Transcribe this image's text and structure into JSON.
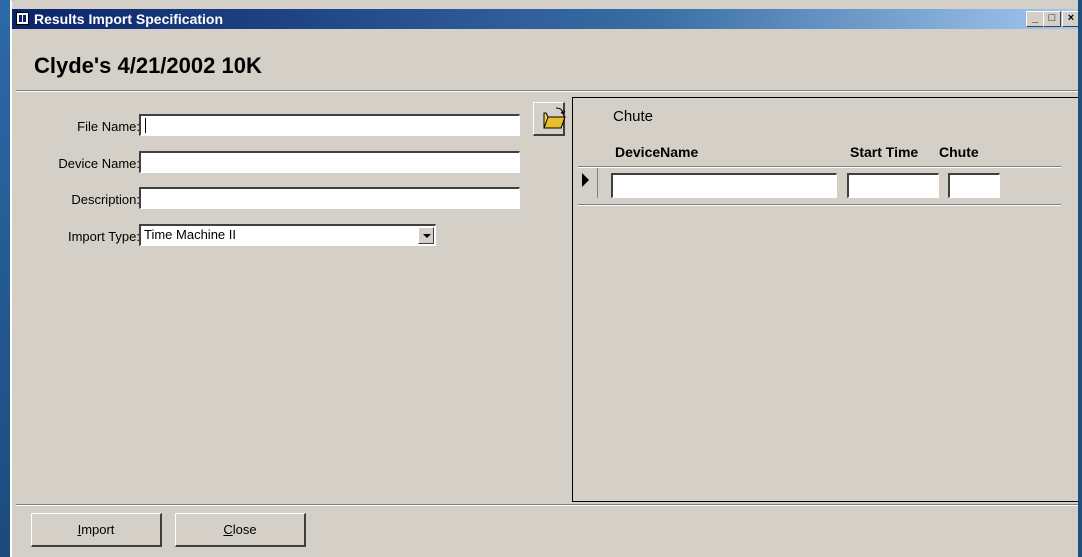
{
  "window": {
    "title": "Results Import Specification",
    "minimize": "_",
    "maximize": "□",
    "close": "×"
  },
  "form": {
    "title": "Clyde's 4/21/2002 10K",
    "file_name_label": "File Name:",
    "file_name_value": "",
    "device_name_label": "Device Name:",
    "device_name_value": "",
    "description_label": "Description:",
    "description_value": "",
    "import_type_label": "Import Type:",
    "import_type_value": "Time Machine II",
    "browse_icon": "folder-open-icon"
  },
  "subform": {
    "caption": "Chute",
    "columns": [
      "DeviceName",
      "Start Time",
      "Chute"
    ],
    "rows": [
      {
        "device_name": "",
        "start_time": "",
        "chute": ""
      }
    ]
  },
  "footer": {
    "import_first": "I",
    "import_rest": "mport",
    "close_first": "C",
    "close_rest": "lose"
  },
  "colors": {
    "titlebar_start": "#0a246a",
    "titlebar_end": "#a6caf0",
    "face": "#d4d0c8"
  }
}
